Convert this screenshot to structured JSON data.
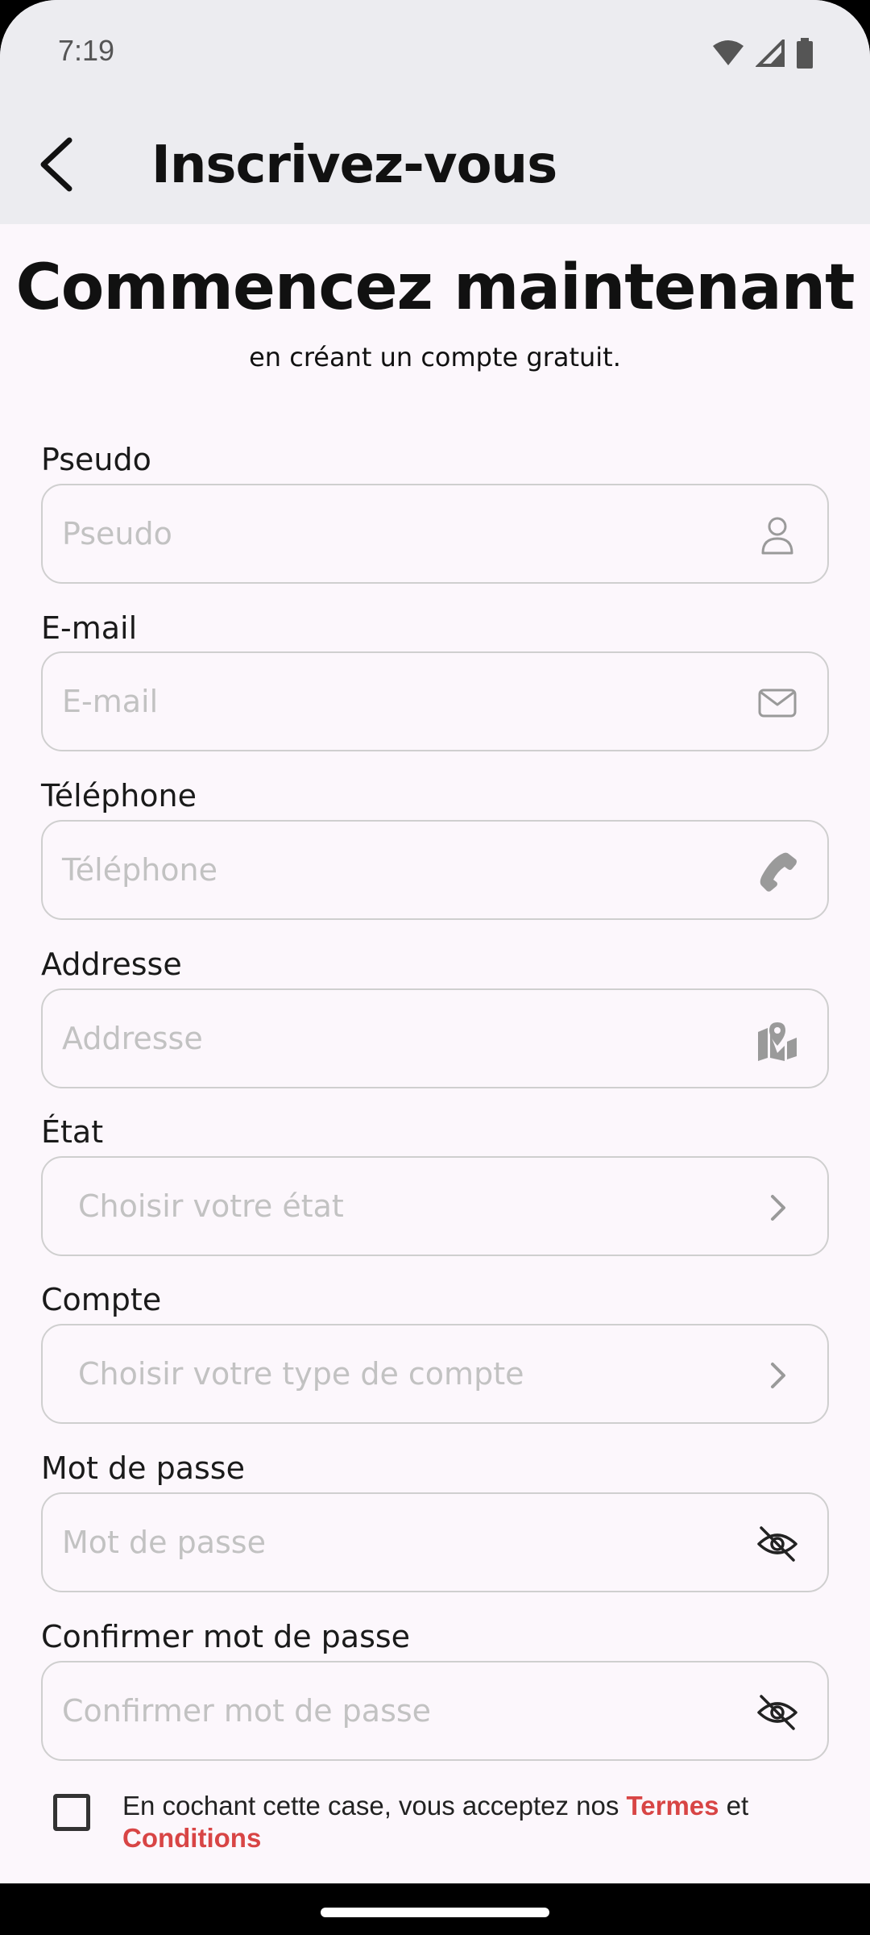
{
  "status_bar": {
    "time": "7:19"
  },
  "app_bar": {
    "title": "Inscrivez-vous"
  },
  "header": {
    "headline": "Commencez maintenant",
    "subline": "en créant un compte gratuit."
  },
  "fields": {
    "pseudo": {
      "label": "Pseudo",
      "placeholder": "Pseudo",
      "icon": "person-icon"
    },
    "email": {
      "label": "E-mail",
      "placeholder": "E-mail",
      "icon": "mail-icon"
    },
    "phone": {
      "label": "Téléphone",
      "placeholder": "Téléphone",
      "icon": "phone-icon"
    },
    "address": {
      "label": "Addresse",
      "placeholder": "Addresse",
      "icon": "map-pin-icon"
    },
    "state": {
      "label": "État",
      "placeholder": "Choisir votre état",
      "icon": "chevron-right-icon"
    },
    "account": {
      "label": "Compte",
      "placeholder": "Choisir votre type de compte",
      "icon": "chevron-right-icon"
    },
    "password": {
      "label": "Mot de passe",
      "placeholder": "Mot de passe",
      "icon": "eye-off-icon"
    },
    "confirm_password": {
      "label": "Confirmer mot de passe",
      "placeholder": "Confirmer mot de passe",
      "icon": "eye-off-icon"
    }
  },
  "terms": {
    "prefix": "En cochant cette case, vous acceptez nos ",
    "terms_link": "Termes",
    "middle": " et ",
    "conditions_link": "Conditions",
    "checked": false
  },
  "colors": {
    "accent": "#d84545",
    "app_bar_bg": "#ececf0",
    "page_bg": "#fcf7fc",
    "placeholder": "#c2c2c2"
  }
}
